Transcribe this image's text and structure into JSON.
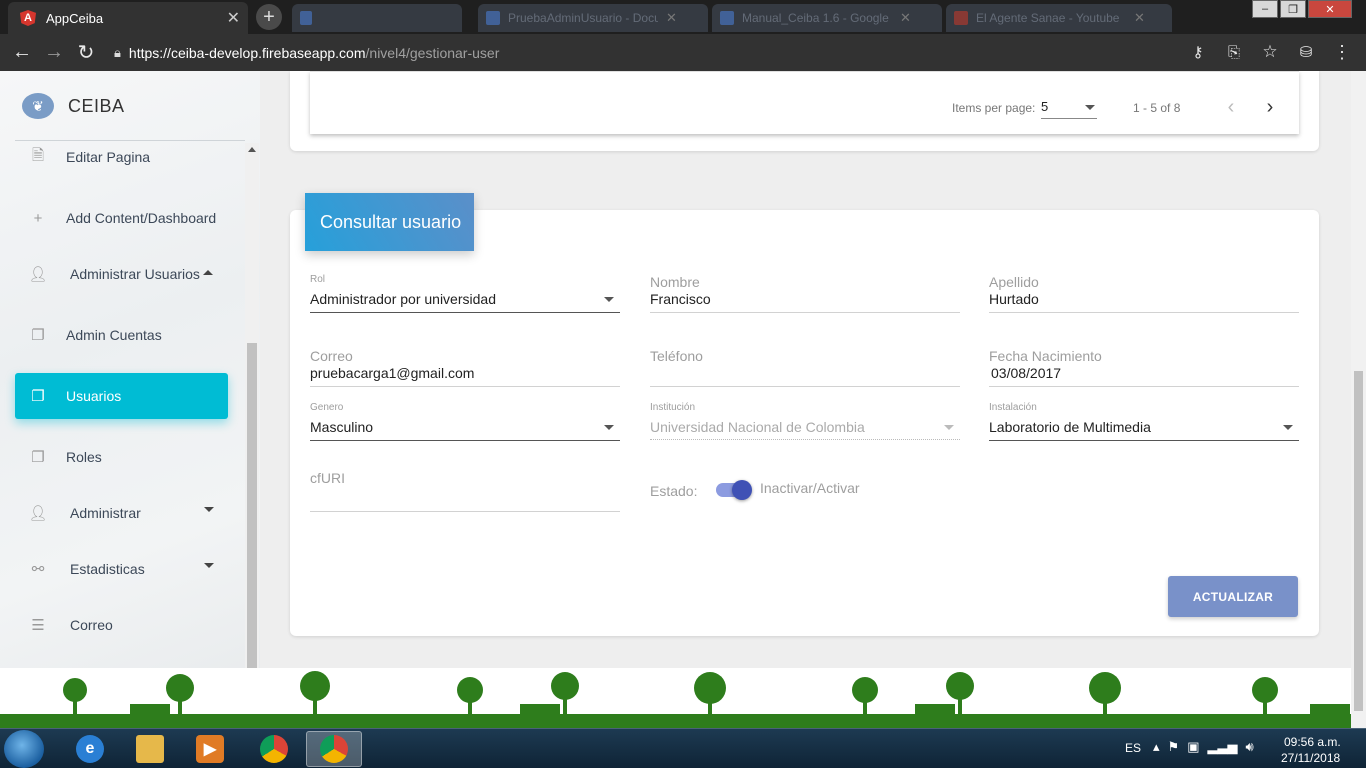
{
  "browser": {
    "active_tab_title": "AppCeiba",
    "url_host": "https://ceiba-develop.firebaseapp.com",
    "url_path": "/nivel4/gestionar-user",
    "ghost_tabs": [
      "",
      "PruebaAdminUsuario - Docum",
      "Manual_Ceiba 1.6 - Google",
      "El Agente Sanae - Youtube"
    ]
  },
  "sidebar": {
    "brand": "CEIBA",
    "items": [
      {
        "label": "Editar Pagina",
        "icon": "document-edit-icon"
      },
      {
        "label": "Add Content/Dashboard",
        "icon": "plus-icon"
      },
      {
        "label": "Administrar Usuarios",
        "icon": "user-check-icon"
      },
      {
        "label": "Admin Cuentas",
        "icon": "copy-icon"
      },
      {
        "label": "Usuarios",
        "icon": "copy-icon"
      },
      {
        "label": "Roles",
        "icon": "copy-icon"
      },
      {
        "label": "Administrar",
        "icon": "user-check-icon"
      },
      {
        "label": "Estadisticas",
        "icon": "network-icon"
      },
      {
        "label": "Correo",
        "icon": "list-icon"
      }
    ]
  },
  "paginator": {
    "items_per_page_label": "Items per page:",
    "items_per_page_value": "5",
    "range": "1 - 5 of 8"
  },
  "form": {
    "title": "Consultar usuario",
    "rol_label": "Rol",
    "rol_value": "Administrador por universidad",
    "nombre_label": "Nombre",
    "nombre_value": "Francisco",
    "apellido_label": "Apellido",
    "apellido_value": "Hurtado",
    "correo_label": "Correo",
    "correo_value": "pruebacarga1@gmail.com",
    "telefono_label": "Teléfono",
    "telefono_value": "",
    "fecha_label": "Fecha Nacimiento",
    "fecha_value": "03/08/2017",
    "genero_label": "Genero",
    "genero_value": "Masculino",
    "institucion_label": "Institución",
    "institucion_value": "Universidad Nacional de Colombia",
    "instalacion_label": "Instalación",
    "instalacion_value": "Laboratorio de Multimedia",
    "cfuri_label": "cfURI",
    "cfuri_value": "",
    "estado_label": "Estado:",
    "toggle_label": "Inactivar/Activar",
    "toggle_on": true,
    "update_button": "ACTUALIZAR"
  },
  "taskbar": {
    "language": "ES",
    "time": "09:56 a.m.",
    "date": "27/11/2018"
  },
  "colors": {
    "active_menu": "#00bcd4",
    "card_header": "#26a0da",
    "toggle": "#3f51b5",
    "button": "#7991c9"
  }
}
